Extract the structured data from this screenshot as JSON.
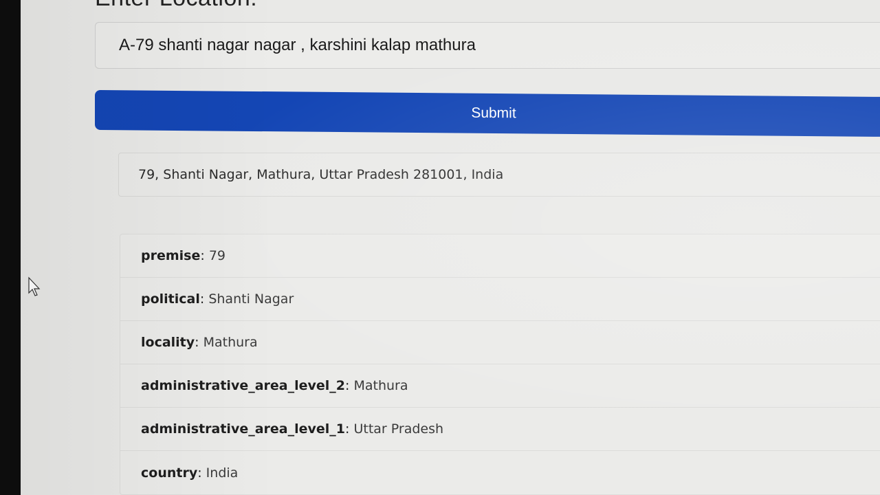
{
  "page": {
    "title": "Enter Location:"
  },
  "location_input": {
    "value": "A-79 shanti nagar nagar , karshini kalap mathura"
  },
  "submit": {
    "label": "Submit"
  },
  "result": {
    "formatted_address": "79, Shanti Nagar, Mathura, Uttar Pradesh 281001, India"
  },
  "components": [
    {
      "key": "premise",
      "value": "79"
    },
    {
      "key": "political",
      "value": "Shanti Nagar"
    },
    {
      "key": "locality",
      "value": "Mathura"
    },
    {
      "key": "administrative_area_level_2",
      "value": "Mathura"
    },
    {
      "key": "administrative_area_level_1",
      "value": "Uttar Pradesh"
    },
    {
      "key": "country",
      "value": "India"
    }
  ],
  "colors": {
    "accent": "#1446b5",
    "background": "#e9e9e7"
  },
  "icons": {
    "cursor": "mouse-cursor-icon"
  }
}
